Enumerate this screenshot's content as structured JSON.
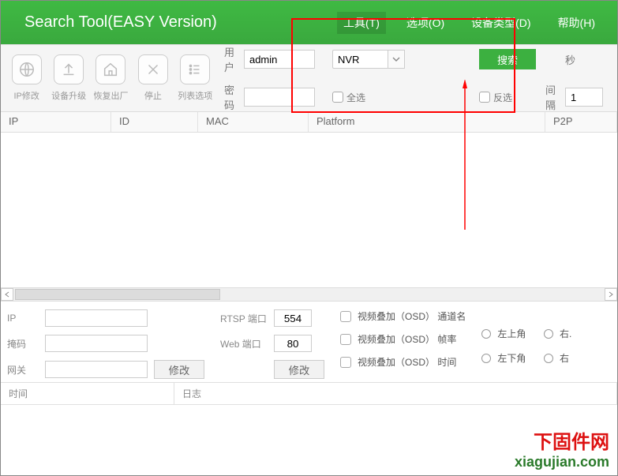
{
  "app": {
    "title": "Search Tool(EASY Version)"
  },
  "menu": {
    "tools": "工具(T)",
    "options": "选项(O)",
    "device_type": "设备类型(D)",
    "help": "帮助(H)"
  },
  "toolbar": {
    "ip_modify": "IP修改",
    "device_upgrade": "设备升级",
    "factory_reset": "恢复出厂",
    "stop": "停止",
    "list_options": "列表选项"
  },
  "form": {
    "user_label": "用户",
    "user_value": "admin",
    "pass_label": "密码",
    "pass_value": "",
    "type_value": "NVR",
    "search_btn": "搜索",
    "select_all": "全选",
    "invert_select": "反选",
    "interval_label": "间隔",
    "interval_value": "1",
    "seconds_label": "秒"
  },
  "columns": {
    "ip": "IP",
    "id": "ID",
    "mac": "MAC",
    "platform": "Platform",
    "p2p": "P2P"
  },
  "bottom": {
    "ip_label": "IP",
    "mask_label": "掩码",
    "gateway_label": "网关",
    "modify1": "修改",
    "rtsp_label": "RTSP 端口",
    "rtsp_value": "554",
    "web_label": "Web 端口",
    "web_value": "80",
    "modify2": "修改",
    "osd_channel": "视频叠加（OSD） 通道名",
    "osd_fps": "视频叠加（OSD） 帧率",
    "osd_time": "视频叠加（OSD） 时间",
    "top_left": "左上角",
    "top_right": "右.",
    "bottom_left": "左下角",
    "bottom_right": "右"
  },
  "log": {
    "time": "时间",
    "log": "日志"
  },
  "watermark": {
    "line1": "下固件网",
    "line2": "xiagujian.com"
  }
}
